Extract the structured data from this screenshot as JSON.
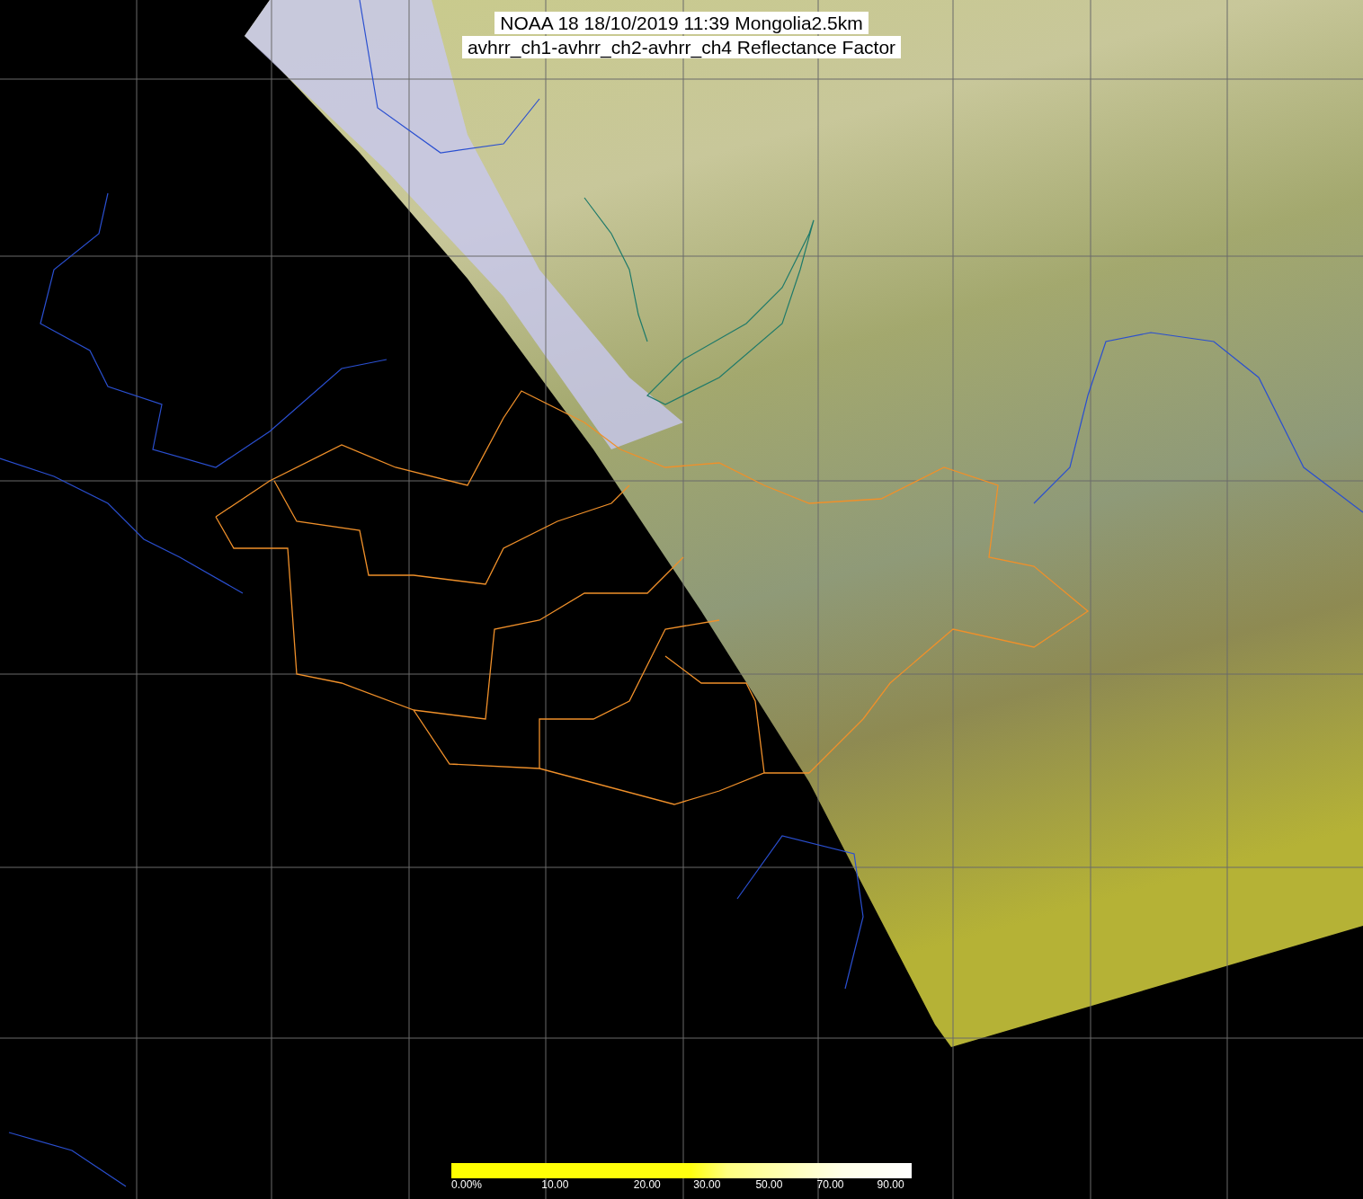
{
  "title": {
    "lines": [
      "NOAA 18 18/10/2019 11:39 Mongolia2.5km",
      "avhrr_ch1-avhrr_ch2-avhrr_ch4 Reflectance Factor"
    ]
  },
  "colorbar": {
    "labels": [
      "0.00%",
      "10.00",
      "20.00",
      "30.00",
      "50.00",
      "70.00",
      "90.00"
    ]
  }
}
